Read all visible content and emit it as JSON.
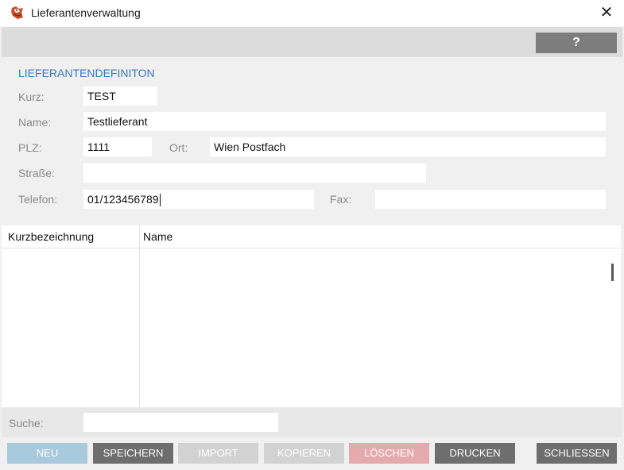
{
  "window": {
    "title": "Lieferantenverwaltung",
    "close_glyph": "✕",
    "app_icon": "fox-logo-icon"
  },
  "toolbar": {
    "help_label": "?"
  },
  "form": {
    "section_title": "LIEFERANTENDEFINITON",
    "kurz": {
      "label": "Kurz:",
      "value": "TEST"
    },
    "name": {
      "label": "Name:",
      "value": "Testlieferant"
    },
    "plz": {
      "label": "PLZ:",
      "value": "1111"
    },
    "ort": {
      "label": "Ort:",
      "value": "Wien Postfach"
    },
    "strasse": {
      "label": "Straße:",
      "value": ""
    },
    "telefon": {
      "label": "Telefon:",
      "value": "01/123456789"
    },
    "fax": {
      "label": "Fax:",
      "value": ""
    }
  },
  "table": {
    "columns": [
      "Kurzbezeichnung",
      "Name"
    ],
    "rows": []
  },
  "search": {
    "label": "Suche:",
    "value": ""
  },
  "buttons": [
    {
      "label": "NEU",
      "color": "#a9c9dd"
    },
    {
      "label": "SPEICHERN",
      "color": "#6e6e6e"
    },
    {
      "label": "IMPORT",
      "color": "#d2d2d2"
    },
    {
      "label": "KOPIEREN",
      "color": "#d2d2d2"
    },
    {
      "label": "LÖSCHEN",
      "color": "#e5aaae"
    },
    {
      "label": "DRUCKEN",
      "color": "#6e6e6e"
    },
    {
      "label": "SCHLIESSEN",
      "color": "#6e6e6e"
    }
  ],
  "colors": {
    "accent": "#3a78c2"
  }
}
